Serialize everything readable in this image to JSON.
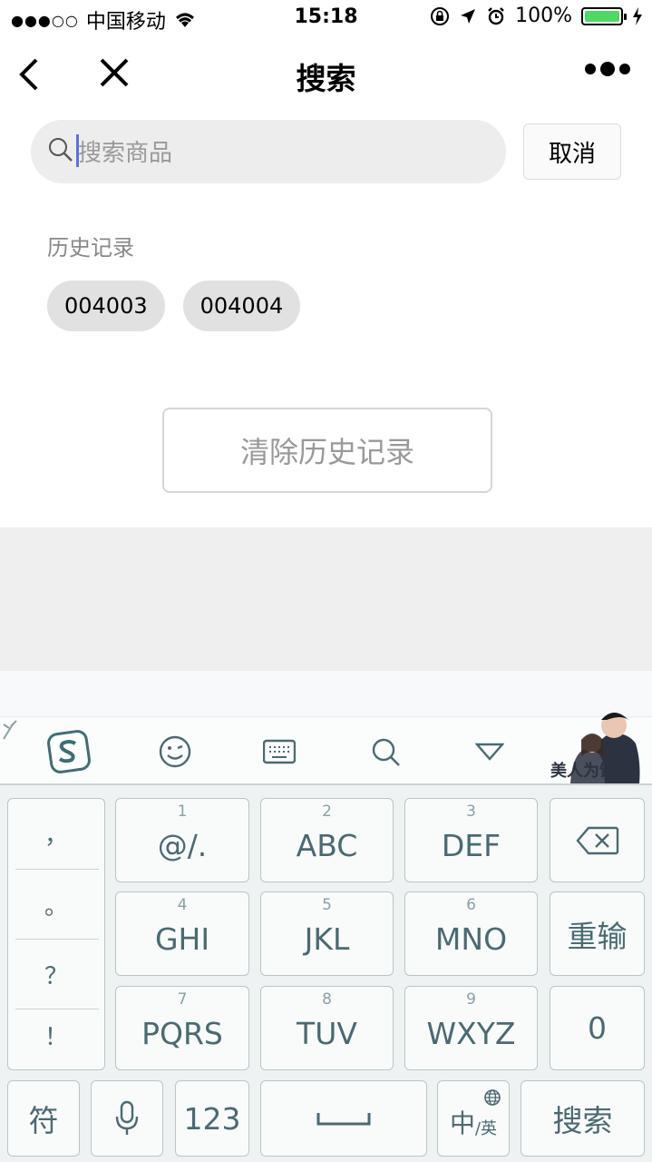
{
  "status_bar": {
    "signal": "●●●○○",
    "carrier": "中国移动",
    "time": "15:18",
    "battery": "100%"
  },
  "nav": {
    "title": "搜索"
  },
  "search": {
    "placeholder": "搜索商品",
    "cancel_label": "取消"
  },
  "history": {
    "label": "历史记录",
    "items": [
      "004003",
      "004004"
    ],
    "clear_label": "清除历史记录"
  },
  "keyboard": {
    "punctuation": [
      "，",
      "。",
      "？",
      "！"
    ],
    "keys": [
      {
        "num": "1",
        "label": "@/."
      },
      {
        "num": "2",
        "label": "ABC"
      },
      {
        "num": "3",
        "label": "DEF"
      },
      {
        "num": "4",
        "label": "GHI"
      },
      {
        "num": "5",
        "label": "JKL"
      },
      {
        "num": "6",
        "label": "MNO"
      },
      {
        "num": "7",
        "label": "PQRS"
      },
      {
        "num": "8",
        "label": "TUV"
      },
      {
        "num": "9",
        "label": "WXYZ"
      }
    ],
    "retype_label": "重输",
    "zero_label": "0",
    "symbol_label": "符",
    "num_label": "123",
    "lang_main": "中",
    "lang_sub": "/英",
    "search_label": "搜索",
    "banner_text": "美人为馅"
  },
  "colors": {
    "battery": "#4cd964",
    "caret": "#5b6ee8",
    "key_text": "#4a6a72"
  }
}
